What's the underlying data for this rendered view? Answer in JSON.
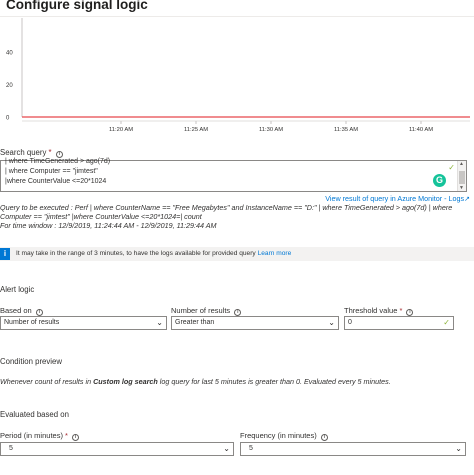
{
  "page": {
    "title": "Configure signal logic"
  },
  "chart_data": {
    "type": "line",
    "y_ticks": [
      "40",
      "20",
      "0"
    ],
    "x_ticks": [
      "11:20 AM",
      "11:25 AM",
      "11:30 AM",
      "11:35 AM",
      "11:40 AM"
    ],
    "series": [
      {
        "values": [
          0,
          0,
          0,
          0,
          0
        ]
      }
    ],
    "series_color": "#e8474c",
    "ylim": [
      0,
      40
    ]
  },
  "search_query": {
    "label": "Search query",
    "required_mark": "*",
    "info_icon": "info-circle-icon",
    "lines": [
      "| where TimeGenerated > ago(7d)",
      "| where Computer == \"jimtest\"",
      "|where CounterValue <=20*1024"
    ],
    "view_result_link": "View result of query in Azure Monitor - Logs",
    "external_icon": "external-link-icon",
    "grammarly_icon": "grammarly-icon",
    "grammarly_letter": "G",
    "executed_line1": "Query to be executed : Perf | where CounterName == \"Free Megabytes\" and InstanceName == \"D:\" | where TimeGenerated > ago(7d) | where",
    "executed_line2": "Computer == \"jimtest\" |where CounterValue <=20*1024=| count",
    "time_window": "For time window : 12/9/2019, 11:24:44 AM - 12/9/2019, 11:29:44 AM"
  },
  "info_banner": {
    "icon": "info-icon",
    "text": "It may take in the range of 3 minutes, to have the logs available for provided query",
    "link": "Learn more"
  },
  "alert_logic": {
    "heading": "Alert logic",
    "based_on": {
      "label": "Based on",
      "value": "Number of results"
    },
    "number_of_results": {
      "label": "Number of results",
      "value": "Greater than"
    },
    "threshold": {
      "label": "Threshold value",
      "required_mark": "*",
      "value": "0"
    }
  },
  "condition_preview": {
    "heading": "Condition preview",
    "text_before": "Whenever count of results in ",
    "text_bold": "Custom log search",
    "text_after": " log query for last 5 minutes is greater than 0. Evaluated every 5 minutes."
  },
  "evaluated": {
    "heading": "Evaluated based on",
    "period": {
      "label": "Period (in minutes)",
      "required_mark": "*",
      "value": "5"
    },
    "frequency": {
      "label": "Frequency (in minutes)",
      "value": "5"
    }
  }
}
